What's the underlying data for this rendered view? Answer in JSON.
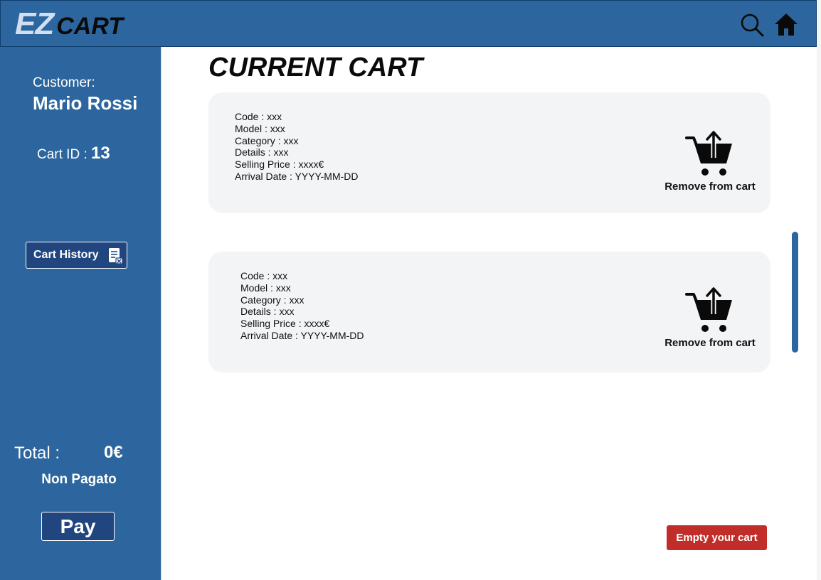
{
  "header": {
    "logo_ez": "EZ",
    "logo_cart": "CART",
    "icons": [
      "search-icon",
      "home-icon"
    ]
  },
  "sidebar": {
    "customer_label": "Customer:",
    "customer_name": "Mario Rossi",
    "cart_id_label": "Cart ID : ",
    "cart_id_value": "13",
    "history_button_label": "Cart History",
    "history_icon": "receipt-icon",
    "total_label": "Total :",
    "total_value": "0€",
    "payment_status": "Non Pagato",
    "pay_button_label": "Pay"
  },
  "main": {
    "title": "CURRENT CART",
    "products": [
      {
        "code": "Code : xxx",
        "model": "Model : xxx",
        "category": "Category : xxx",
        "details": "Details : xxx",
        "selling_price": "Selling Price : xxxx€",
        "arrival_date": "Arrival Date : YYYY-MM-DD",
        "action_label": "Remove from cart",
        "action_icon": "cart-remove-icon"
      },
      {
        "code": "Code : xxx",
        "model": "Model : xxx",
        "category": "Category : xxx",
        "details": "Details : xxx",
        "selling_price": "Selling Price : xxxx€",
        "arrival_date": "Arrival Date : YYYY-MM-DD",
        "action_label": "Remove from cart",
        "action_icon": "cart-remove-icon"
      }
    ],
    "empty_cart_label": "Empty your cart"
  },
  "colors": {
    "primary": "#2d669e",
    "button_dark": "#21457e",
    "danger": "#c12e2a",
    "card_bg": "#f3f4f6",
    "logo_light": "#d2dff0"
  }
}
